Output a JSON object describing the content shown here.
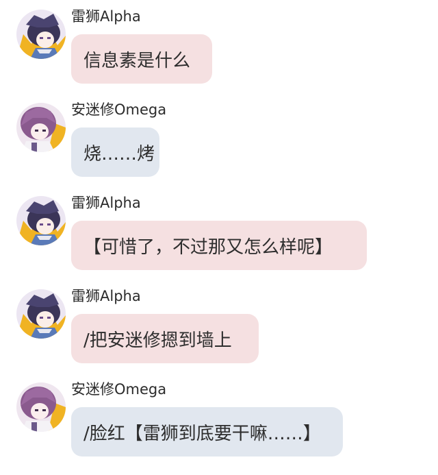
{
  "colors": {
    "alpha_bubble": "#f5e0e1",
    "omega_bubble": "#e1e7ef",
    "text": "#2d2d2d"
  },
  "messages": [
    {
      "sender": "雷狮Alpha",
      "role": "alpha",
      "avatar": "lion-avatar-icon",
      "text": "信息素是什么"
    },
    {
      "sender": "安迷修Omega",
      "role": "omega",
      "avatar": "knight-avatar-icon",
      "text": "烧……烤"
    },
    {
      "sender": "雷狮Alpha",
      "role": "alpha",
      "avatar": "lion-avatar-icon",
      "text": "【可惜了，不过那又怎么样呢】"
    },
    {
      "sender": "雷狮Alpha",
      "role": "alpha",
      "avatar": "lion-avatar-icon",
      "text": "/把安迷修摁到墙上"
    },
    {
      "sender": "安迷修Omega",
      "role": "omega",
      "avatar": "knight-avatar-icon",
      "text": "/脸红【雷狮到底要干嘛……】"
    }
  ]
}
